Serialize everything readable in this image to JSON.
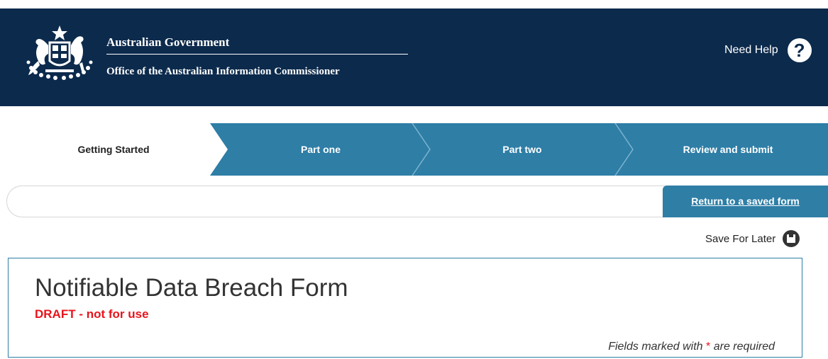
{
  "header": {
    "gov_title": "Australian Government",
    "gov_subtitle": "Office of the Australian Information Commissioner",
    "need_help": "Need Help",
    "help_icon_glyph": "?",
    "background_color": "#0c2a4c"
  },
  "steps": {
    "items": [
      {
        "label": "Getting Started",
        "state": "active"
      },
      {
        "label": "Part one",
        "state": "inactive"
      },
      {
        "label": "Part two",
        "state": "inactive"
      },
      {
        "label": "Review and submit",
        "state": "inactive"
      }
    ],
    "active_color": "#ffffff",
    "inactive_color": "#2e7ea6"
  },
  "saved_form": {
    "return_link": "Return to a saved form"
  },
  "save_for_later": {
    "label": "Save For Later",
    "icon": "save-disk-icon"
  },
  "form": {
    "title": "Notifiable Data Breach Form",
    "draft_notice": "DRAFT - not for use",
    "required_prefix": "Fields marked with",
    "required_star": "*",
    "required_suffix": "are required"
  }
}
